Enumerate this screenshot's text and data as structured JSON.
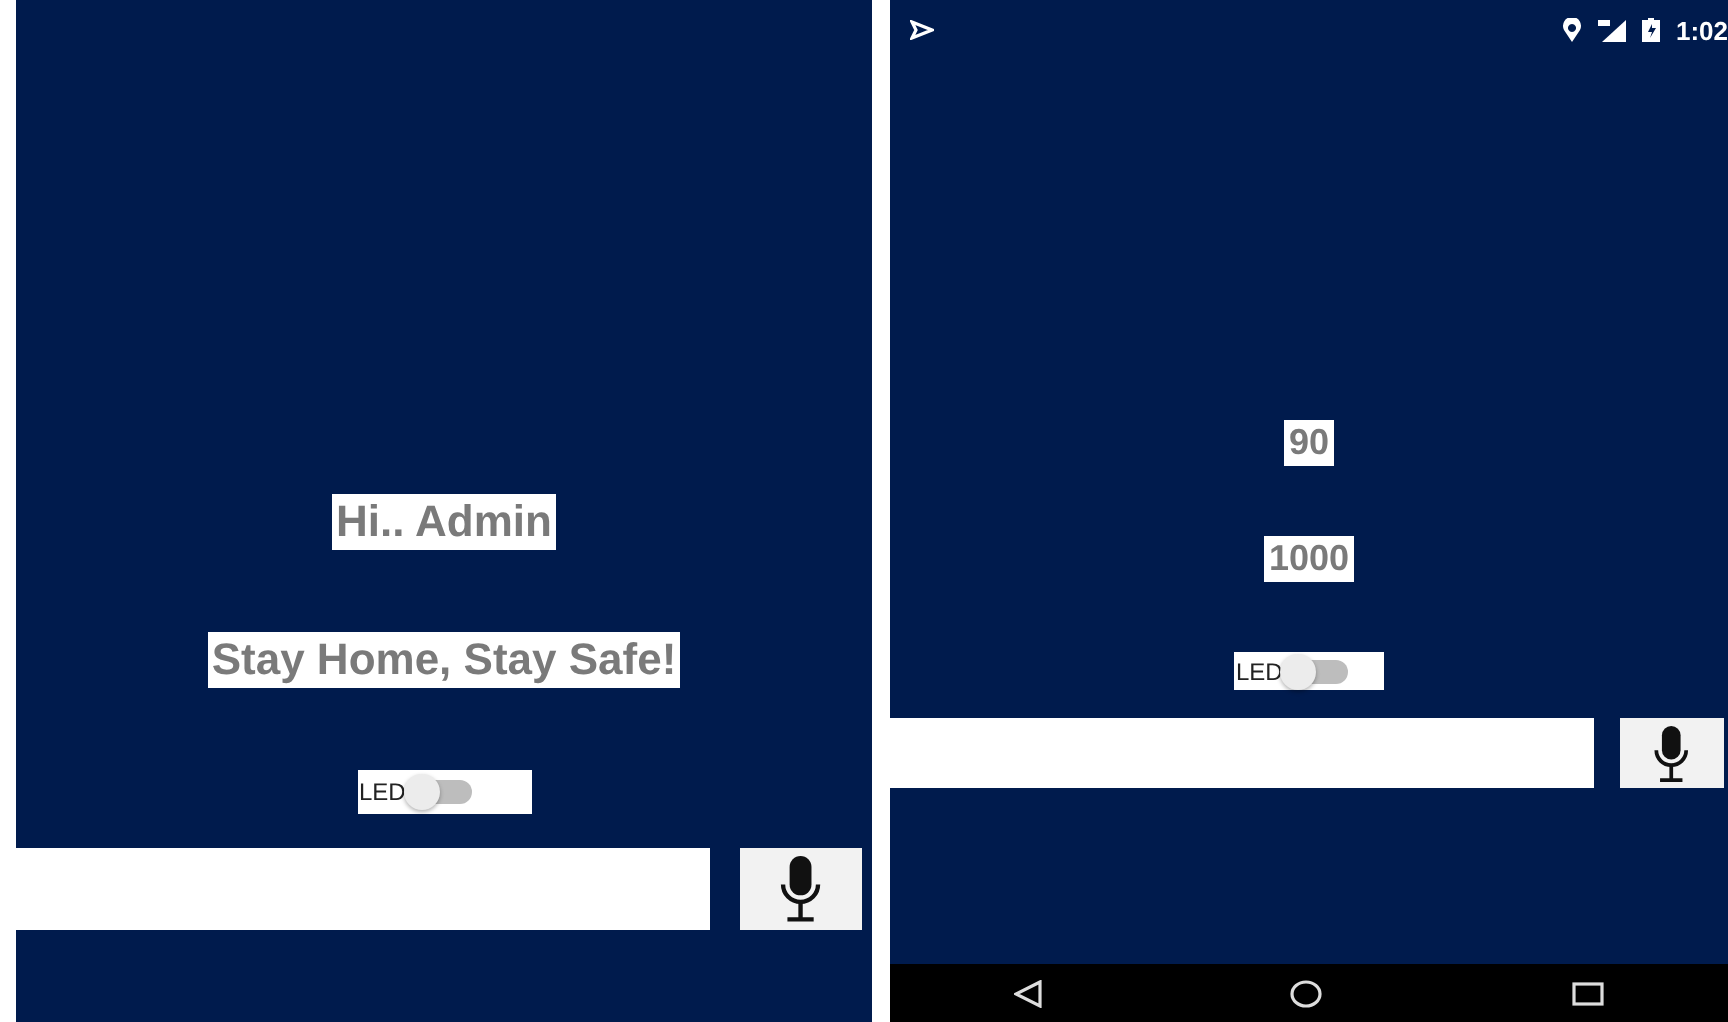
{
  "screens": [
    {
      "kind": "app",
      "labels": [
        "Hi.. Admin",
        "Stay Home, Stay Safe!"
      ],
      "led": {
        "label": "LED",
        "on": false
      }
    },
    {
      "kind": "device",
      "status_bar": {
        "time": "1:02"
      },
      "labels": [
        "90",
        "1000"
      ],
      "led": {
        "label": "LED",
        "on": false
      }
    }
  ]
}
